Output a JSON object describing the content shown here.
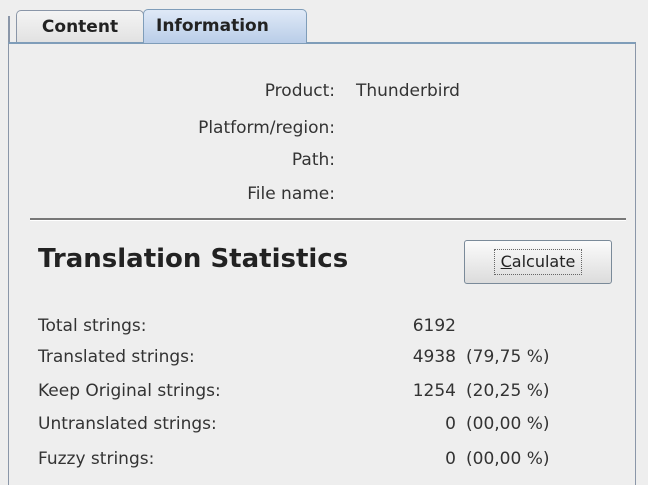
{
  "tabs": [
    {
      "label": "Content"
    },
    {
      "label": "Information"
    }
  ],
  "info": {
    "product_label": "Product:",
    "product_value": "Thunderbird",
    "platform_label": "Platform/region:",
    "platform_value": "",
    "path_label": "Path:",
    "path_value": "",
    "filename_label": "File name:",
    "filename_value": ""
  },
  "stats": {
    "heading": "Translation Statistics",
    "calculate_prefix": "",
    "calculate_mnemonic": "C",
    "calculate_rest": "alculate",
    "rows": [
      {
        "label": "Total strings:",
        "count": "6192",
        "percent": ""
      },
      {
        "label": "Translated strings:",
        "count": "4938",
        "percent": "(79,75 %)"
      },
      {
        "label": "Keep Original strings:",
        "count": "1254",
        "percent": "(20,25 %)"
      },
      {
        "label": "Untranslated strings:",
        "count": "0",
        "percent": "(00,00 %)"
      },
      {
        "label": "Fuzzy strings:",
        "count": "0",
        "percent": "(00,00 %)"
      }
    ]
  },
  "colors": {
    "active_tab": "#b9cde8",
    "tab_border": "#7f9db9",
    "background": "#eeeeee"
  }
}
